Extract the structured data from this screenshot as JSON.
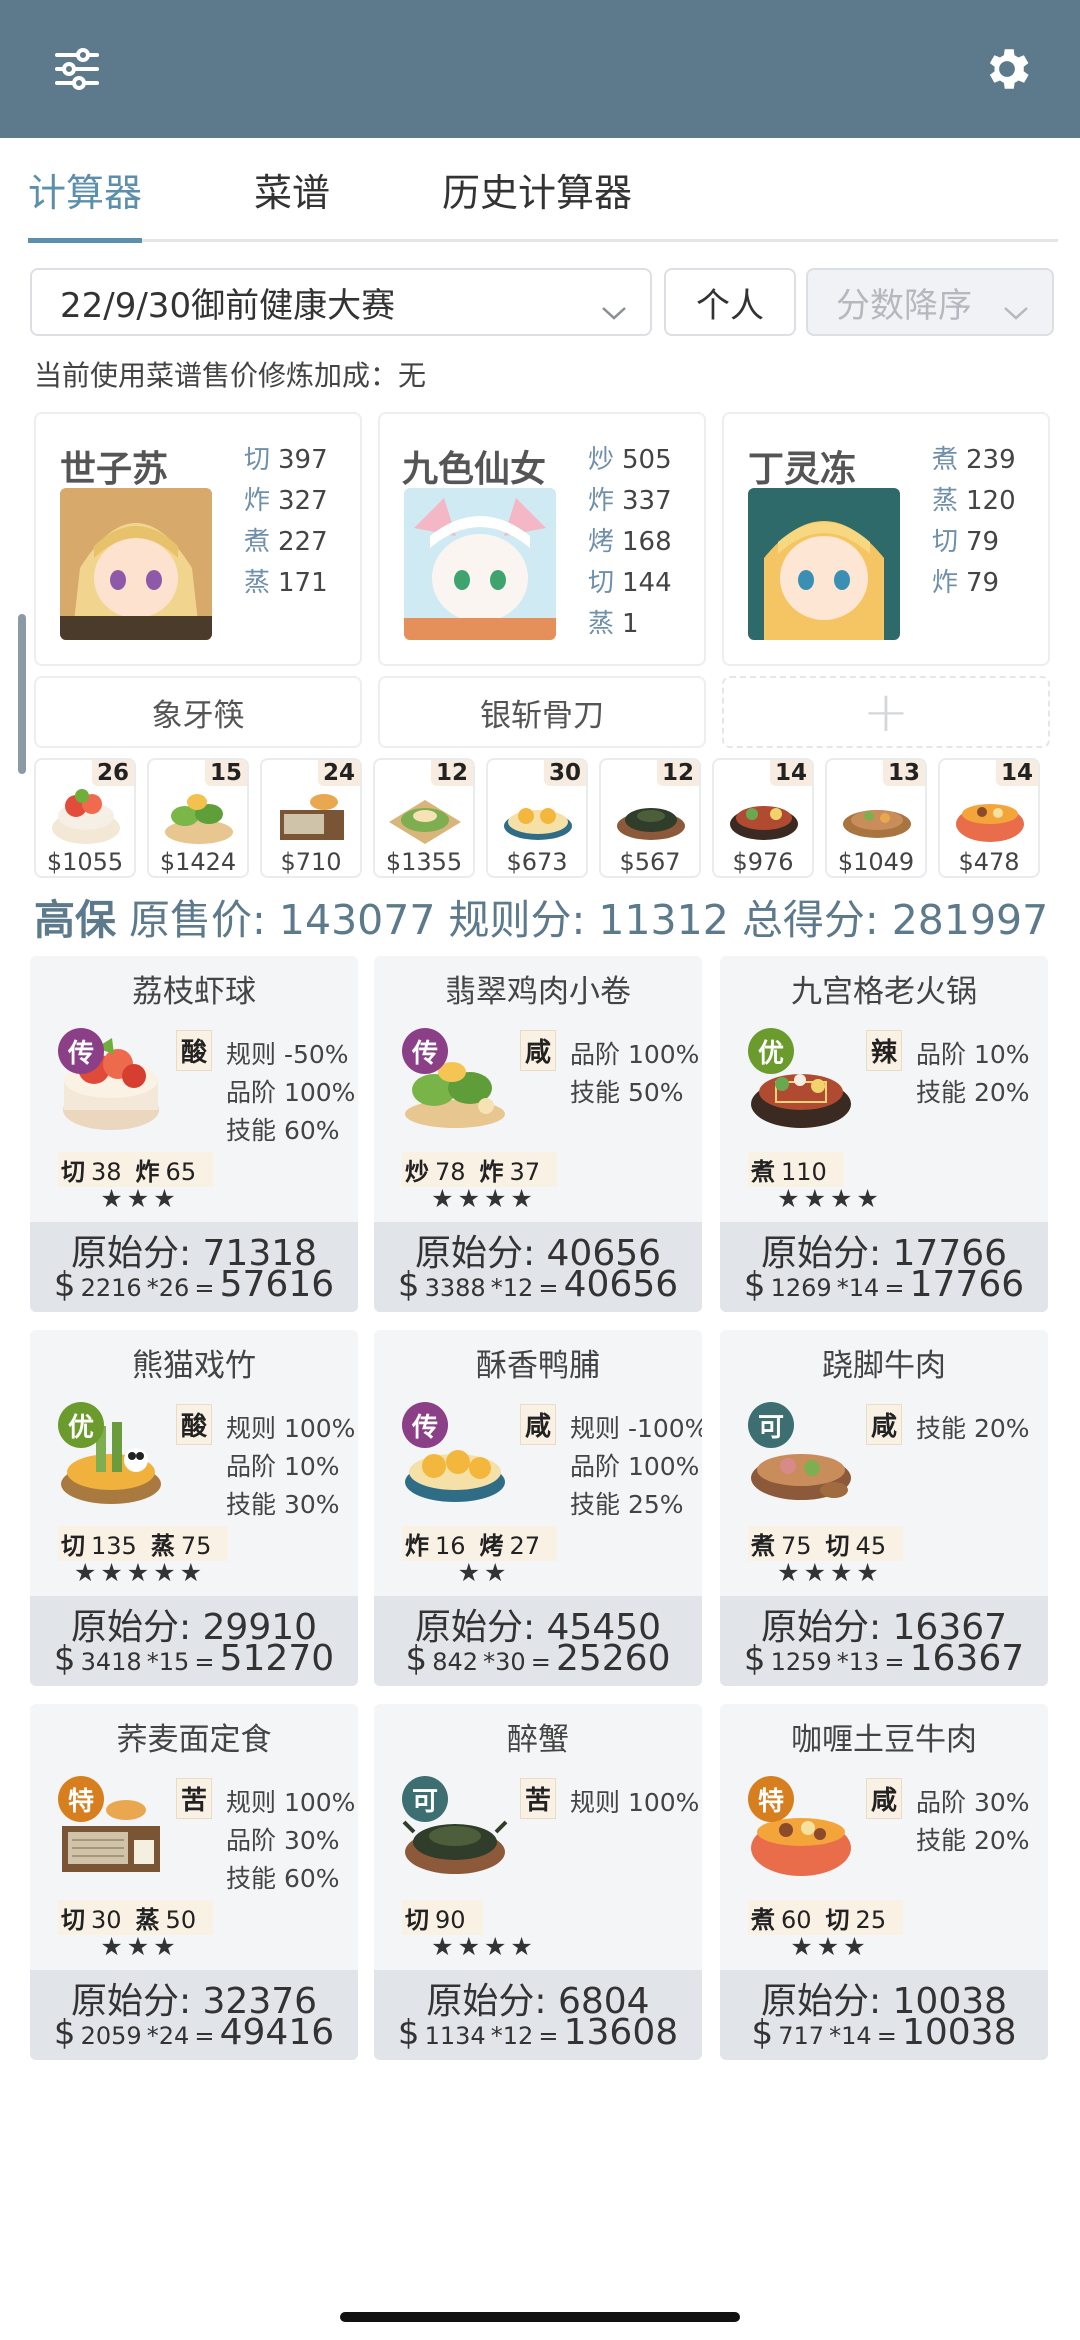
{
  "toolbar": {
    "filter_icon": "sliders-icon",
    "settings_icon": "gear-icon"
  },
  "tabs": [
    {
      "label": "计算器",
      "active": true
    },
    {
      "label": "菜谱",
      "active": false
    },
    {
      "label": "历史计算器",
      "active": false
    }
  ],
  "filters": {
    "contest": "22/9/30御前健康大赛",
    "mode": "个人",
    "sort": "分数降序"
  },
  "note": "当前使用菜谱售价修炼加成：无",
  "chefs": [
    {
      "name": "世子苏",
      "skills": [
        {
          "k": "切",
          "v": "397"
        },
        {
          "k": "炸",
          "v": "327"
        },
        {
          "k": "煮",
          "v": "227"
        },
        {
          "k": "蒸",
          "v": "171"
        }
      ]
    },
    {
      "name": "九色仙女",
      "skills": [
        {
          "k": "炒",
          "v": "505"
        },
        {
          "k": "炸",
          "v": "337"
        },
        {
          "k": "烤",
          "v": "168"
        },
        {
          "k": "切",
          "v": "144"
        },
        {
          "k": "蒸",
          "v": "1"
        }
      ]
    },
    {
      "name": "丁灵冻",
      "skills": [
        {
          "k": "煮",
          "v": "239"
        },
        {
          "k": "蒸",
          "v": "120"
        },
        {
          "k": "切",
          "v": "79"
        },
        {
          "k": "炸",
          "v": "79"
        }
      ]
    }
  ],
  "equips": [
    "象牙筷",
    "银斩骨刀",
    "+"
  ],
  "mini_dishes": [
    {
      "count": "26",
      "price": "$1055"
    },
    {
      "count": "15",
      "price": "$1424"
    },
    {
      "count": "24",
      "price": "$710"
    },
    {
      "count": "12",
      "price": "$1355"
    },
    {
      "count": "30",
      "price": "$673"
    },
    {
      "count": "12",
      "price": "$567"
    },
    {
      "count": "14",
      "price": "$976"
    },
    {
      "count": "13",
      "price": "$1049"
    },
    {
      "count": "14",
      "price": "$478"
    }
  ],
  "summary": {
    "level": "高保",
    "orig_label": "原售价:",
    "orig": "143077",
    "rule_label": "规则分:",
    "rule": "11312",
    "total_label": "总得分:",
    "total": "281997"
  },
  "dishes": [
    {
      "name": "荔枝虾球",
      "rarity": "传",
      "rarity_color": "#8a3f86",
      "condiment": "酸",
      "mods": [
        "规则 -50%",
        "品阶 100%",
        "技能 60%"
      ],
      "reqs": [
        {
          "k": "切",
          "v": "38"
        },
        {
          "k": "炸",
          "v": "65"
        }
      ],
      "stars": "★★★",
      "raw": "原始分: 71318",
      "price": "2216",
      "mult": "*26",
      "total": "57616"
    },
    {
      "name": "翡翠鸡肉小卷",
      "rarity": "传",
      "rarity_color": "#8a3f86",
      "condiment": "咸",
      "mods": [
        "品阶 100%",
        "技能 50%"
      ],
      "reqs": [
        {
          "k": "炒",
          "v": "78"
        },
        {
          "k": "炸",
          "v": "37"
        }
      ],
      "stars": "★★★★",
      "raw": "原始分: 40656",
      "price": "3388",
      "mult": "*12",
      "total": "40656"
    },
    {
      "name": "九宫格老火锅",
      "rarity": "优",
      "rarity_color": "#6b9b2d",
      "condiment": "辣",
      "mods": [
        "品阶 10%",
        "技能 20%"
      ],
      "reqs": [
        {
          "k": "煮",
          "v": "110"
        }
      ],
      "stars": "★★★★",
      "raw": "原始分: 17766",
      "price": "1269",
      "mult": "*14",
      "total": "17766"
    },
    {
      "name": "熊猫戏竹",
      "rarity": "优",
      "rarity_color": "#6b9b2d",
      "condiment": "酸",
      "mods": [
        "规则 100%",
        "品阶 10%",
        "技能 30%"
      ],
      "reqs": [
        {
          "k": "切",
          "v": "135"
        },
        {
          "k": "蒸",
          "v": "75"
        }
      ],
      "stars": "★★★★★",
      "raw": "原始分: 29910",
      "price": "3418",
      "mult": "*15",
      "total": "51270"
    },
    {
      "name": "酥香鸭脯",
      "rarity": "传",
      "rarity_color": "#8a3f86",
      "condiment": "咸",
      "mods": [
        "规则 -100%",
        "品阶 100%",
        "技能 25%"
      ],
      "reqs": [
        {
          "k": "炸",
          "v": "16"
        },
        {
          "k": "烤",
          "v": "27"
        }
      ],
      "stars": "★★",
      "raw": "原始分: 45450",
      "price": "842",
      "mult": "*30",
      "total": "25260"
    },
    {
      "name": "跷脚牛肉",
      "rarity": "可",
      "rarity_color": "#3d6f72",
      "condiment": "咸",
      "mods": [
        "技能 20%"
      ],
      "reqs": [
        {
          "k": "煮",
          "v": "75"
        },
        {
          "k": "切",
          "v": "45"
        }
      ],
      "stars": "★★★★",
      "raw": "原始分: 16367",
      "price": "1259",
      "mult": "*13",
      "total": "16367"
    },
    {
      "name": "荞麦面定食",
      "rarity": "特",
      "rarity_color": "#d77f1f",
      "condiment": "苦",
      "mods": [
        "规则 100%",
        "品阶 30%",
        "技能 60%"
      ],
      "reqs": [
        {
          "k": "切",
          "v": "30"
        },
        {
          "k": "蒸",
          "v": "50"
        }
      ],
      "stars": "★★★",
      "raw": "原始分: 32376",
      "price": "2059",
      "mult": "*24",
      "total": "49416"
    },
    {
      "name": "醉蟹",
      "rarity": "可",
      "rarity_color": "#3d6f72",
      "condiment": "苦",
      "mods": [
        "规则 100%"
      ],
      "reqs": [
        {
          "k": "切",
          "v": "90"
        }
      ],
      "stars": "★★★★",
      "raw": "原始分: 6804",
      "price": "1134",
      "mult": "*12",
      "total": "13608"
    },
    {
      "name": "咖喱土豆牛肉",
      "rarity": "特",
      "rarity_color": "#d77f1f",
      "condiment": "咸",
      "mods": [
        "品阶 30%",
        "技能 20%"
      ],
      "reqs": [
        {
          "k": "煮",
          "v": "60"
        },
        {
          "k": "切",
          "v": "25"
        }
      ],
      "stars": "★★★",
      "raw": "原始分: 10038",
      "price": "717",
      "mult": "*14",
      "total": "10038"
    }
  ]
}
